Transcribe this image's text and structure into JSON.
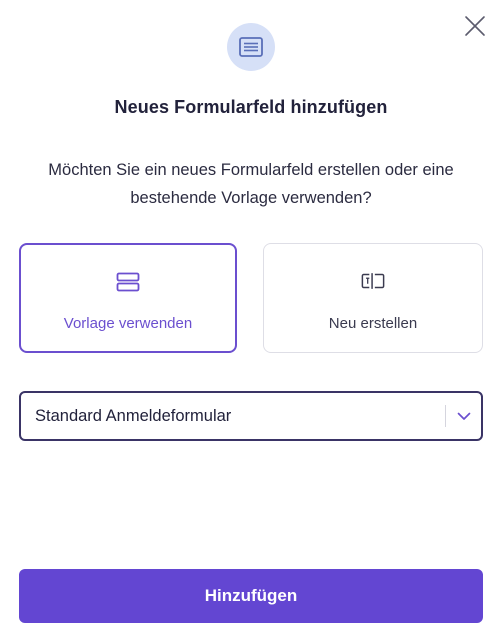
{
  "modal": {
    "title": "Neues Formularfeld hinzufügen",
    "description": "Möchten Sie ein neues Formularfeld erstellen oder eine bestehende Vorlage verwenden?",
    "header_icon": "form-list-icon",
    "close_icon": "close-icon"
  },
  "options": [
    {
      "label": "Vorlage verwenden",
      "icon": "template-icon",
      "selected": true
    },
    {
      "label": "Neu erstellen",
      "icon": "text-field-icon",
      "selected": false
    }
  ],
  "template_select": {
    "value": "Standard Anmeldeformular",
    "icon": "chevron-down-icon"
  },
  "submit": {
    "label": "Hinzufügen"
  },
  "colors": {
    "accent": "#6346d2",
    "selected_border": "#6b4fcf",
    "icon_bg": "#d6e0f7",
    "icon_fg": "#5a6fb8"
  }
}
